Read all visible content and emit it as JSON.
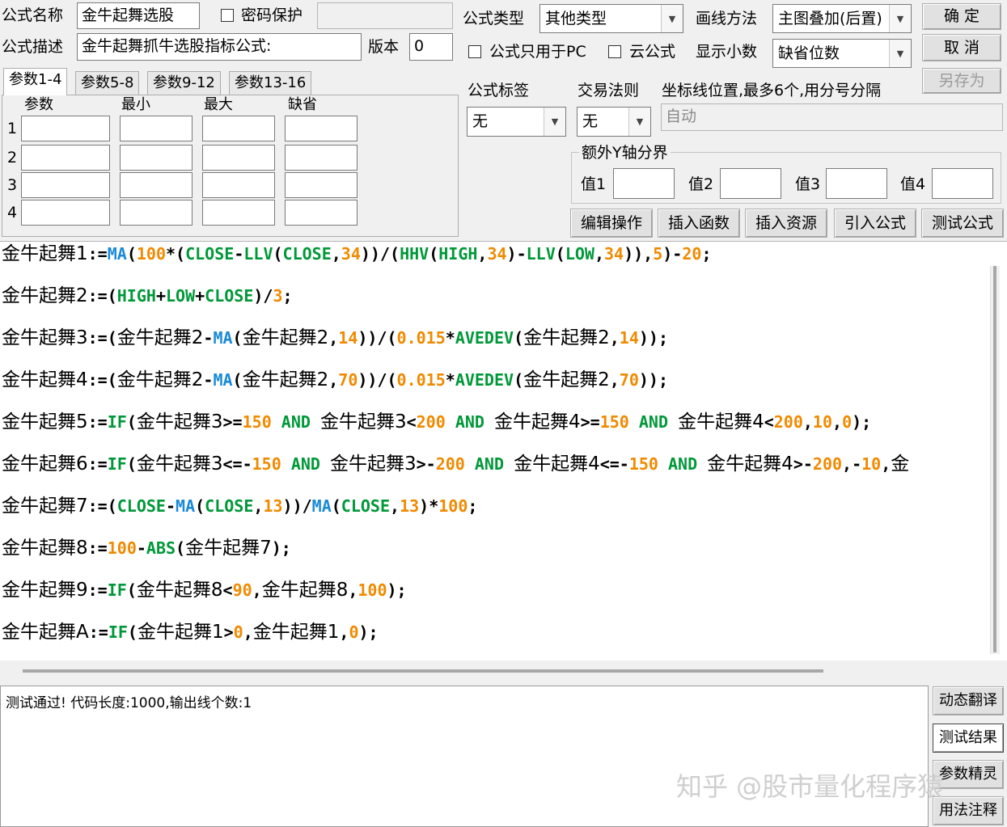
{
  "header": {
    "formula_name_label": "公式名称",
    "formula_name_value": "金牛起舞选股",
    "password_label": "密码保护",
    "formula_desc_label": "公式描述",
    "formula_desc_value": "金牛起舞抓牛选股指标公式:",
    "version_label": "版本",
    "version_value": "0",
    "formula_type_label": "公式类型",
    "formula_type_value": "其他类型",
    "draw_method_label": "画线方法",
    "draw_method_value": "主图叠加(后置)",
    "pc_only_label": "公式只用于PC",
    "cloud_label": "云公式",
    "decimals_label": "显示小数",
    "decimals_value": "缺省位数"
  },
  "buttons": {
    "ok": "确 定",
    "cancel": "取 消",
    "save_as": "另存为",
    "edit_ops": "编辑操作",
    "insert_func": "插入函数",
    "insert_res": "插入资源",
    "import_formula": "引入公式",
    "test_formula": "测试公式",
    "dyn_translate": "动态翻译",
    "test_result": "测试结果",
    "param_wizard": "参数精灵",
    "usage_notes": "用法注释"
  },
  "tabs": [
    "参数1-4",
    "参数5-8",
    "参数9-12",
    "参数13-16"
  ],
  "params": {
    "col_headers": [
      "参数",
      "最小",
      "最大",
      "缺省"
    ],
    "rows": [
      "1",
      "2",
      "3",
      "4"
    ]
  },
  "right_panel": {
    "tag_label": "公式标签",
    "tag_value": "无",
    "trade_rule_label": "交易法则",
    "trade_rule_value": "无",
    "axis_label": "坐标线位置,最多6个,用分号分隔",
    "axis_value": "自动",
    "yaxis_group": "额外Y轴分界",
    "values": [
      "值1",
      "值2",
      "值3",
      "值4"
    ]
  },
  "code_lines": [
    [
      [
        "cn",
        "金牛起舞1"
      ],
      [
        "op",
        ":="
      ],
      [
        "fn",
        "MA"
      ],
      [
        "op",
        "("
      ],
      [
        "num",
        "100"
      ],
      [
        "op",
        "*("
      ],
      [
        "var",
        "CLOSE"
      ],
      [
        "op",
        "-"
      ],
      [
        "var",
        "LLV"
      ],
      [
        "op",
        "("
      ],
      [
        "var",
        "CLOSE"
      ],
      [
        "op",
        ","
      ],
      [
        "num",
        "34"
      ],
      [
        "op",
        "))/("
      ],
      [
        "var",
        "HHV"
      ],
      [
        "op",
        "("
      ],
      [
        "var",
        "HIGH"
      ],
      [
        "op",
        ","
      ],
      [
        "num",
        "34"
      ],
      [
        "op",
        ")-"
      ],
      [
        "var",
        "LLV"
      ],
      [
        "op",
        "("
      ],
      [
        "var",
        "LOW"
      ],
      [
        "op",
        ","
      ],
      [
        "num",
        "34"
      ],
      [
        "op",
        ")),"
      ],
      [
        "num",
        "5"
      ],
      [
        "op",
        ")-"
      ],
      [
        "num",
        "20"
      ],
      [
        "op",
        ";"
      ]
    ],
    [
      [
        "cn",
        "金牛起舞2"
      ],
      [
        "op",
        ":=("
      ],
      [
        "var",
        "HIGH"
      ],
      [
        "op",
        "+"
      ],
      [
        "var",
        "LOW"
      ],
      [
        "op",
        "+"
      ],
      [
        "var",
        "CLOSE"
      ],
      [
        "op",
        ")/"
      ],
      [
        "num",
        "3"
      ],
      [
        "op",
        ";"
      ]
    ],
    [
      [
        "cn",
        "金牛起舞3"
      ],
      [
        "op",
        ":=("
      ],
      [
        "cn",
        "金牛起舞2"
      ],
      [
        "op",
        "-"
      ],
      [
        "fn",
        "MA"
      ],
      [
        "op",
        "("
      ],
      [
        "cn",
        "金牛起舞2"
      ],
      [
        "op",
        ","
      ],
      [
        "num",
        "14"
      ],
      [
        "op",
        "))/("
      ],
      [
        "num",
        "0.015"
      ],
      [
        "op",
        "*"
      ],
      [
        "var",
        "AVEDEV"
      ],
      [
        "op",
        "("
      ],
      [
        "cn",
        "金牛起舞2"
      ],
      [
        "op",
        ","
      ],
      [
        "num",
        "14"
      ],
      [
        "op",
        "));"
      ]
    ],
    [
      [
        "cn",
        "金牛起舞4"
      ],
      [
        "op",
        ":=("
      ],
      [
        "cn",
        "金牛起舞2"
      ],
      [
        "op",
        "-"
      ],
      [
        "fn",
        "MA"
      ],
      [
        "op",
        "("
      ],
      [
        "cn",
        "金牛起舞2"
      ],
      [
        "op",
        ","
      ],
      [
        "num",
        "70"
      ],
      [
        "op",
        "))/("
      ],
      [
        "num",
        "0.015"
      ],
      [
        "op",
        "*"
      ],
      [
        "var",
        "AVEDEV"
      ],
      [
        "op",
        "("
      ],
      [
        "cn",
        "金牛起舞2"
      ],
      [
        "op",
        ","
      ],
      [
        "num",
        "70"
      ],
      [
        "op",
        "));"
      ]
    ],
    [
      [
        "cn",
        "金牛起舞5"
      ],
      [
        "op",
        ":="
      ],
      [
        "var",
        "IF"
      ],
      [
        "op",
        "("
      ],
      [
        "cn",
        "金牛起舞3"
      ],
      [
        "op",
        ">="
      ],
      [
        "num",
        "150"
      ],
      [
        "op",
        " "
      ],
      [
        "var",
        "AND"
      ],
      [
        "op",
        " "
      ],
      [
        "cn",
        "金牛起舞3"
      ],
      [
        "op",
        "<"
      ],
      [
        "num",
        "200"
      ],
      [
        "op",
        " "
      ],
      [
        "var",
        "AND"
      ],
      [
        "op",
        " "
      ],
      [
        "cn",
        "金牛起舞4"
      ],
      [
        "op",
        ">="
      ],
      [
        "num",
        "150"
      ],
      [
        "op",
        " "
      ],
      [
        "var",
        "AND"
      ],
      [
        "op",
        " "
      ],
      [
        "cn",
        "金牛起舞4"
      ],
      [
        "op",
        "<"
      ],
      [
        "num",
        "200"
      ],
      [
        "op",
        ","
      ],
      [
        "num",
        "10"
      ],
      [
        "op",
        ","
      ],
      [
        "num",
        "0"
      ],
      [
        "op",
        ");"
      ]
    ],
    [
      [
        "cn",
        "金牛起舞6"
      ],
      [
        "op",
        ":="
      ],
      [
        "var",
        "IF"
      ],
      [
        "op",
        "("
      ],
      [
        "cn",
        "金牛起舞3"
      ],
      [
        "op",
        "<=-"
      ],
      [
        "num",
        "150"
      ],
      [
        "op",
        " "
      ],
      [
        "var",
        "AND"
      ],
      [
        "op",
        " "
      ],
      [
        "cn",
        "金牛起舞3"
      ],
      [
        "op",
        ">-"
      ],
      [
        "num",
        "200"
      ],
      [
        "op",
        " "
      ],
      [
        "var",
        "AND"
      ],
      [
        "op",
        " "
      ],
      [
        "cn",
        "金牛起舞4"
      ],
      [
        "op",
        "<=-"
      ],
      [
        "num",
        "150"
      ],
      [
        "op",
        " "
      ],
      [
        "var",
        "AND"
      ],
      [
        "op",
        " "
      ],
      [
        "cn",
        "金牛起舞4"
      ],
      [
        "op",
        ">-"
      ],
      [
        "num",
        "200"
      ],
      [
        "op",
        ",-"
      ],
      [
        "num",
        "10"
      ],
      [
        "op",
        ","
      ],
      [
        "cn",
        "金"
      ]
    ],
    [
      [
        "cn",
        "金牛起舞7"
      ],
      [
        "op",
        ":=("
      ],
      [
        "var",
        "CLOSE"
      ],
      [
        "op",
        "-"
      ],
      [
        "fn",
        "MA"
      ],
      [
        "op",
        "("
      ],
      [
        "var",
        "CLOSE"
      ],
      [
        "op",
        ","
      ],
      [
        "num",
        "13"
      ],
      [
        "op",
        "))/"
      ],
      [
        "fn",
        "MA"
      ],
      [
        "op",
        "("
      ],
      [
        "var",
        "CLOSE"
      ],
      [
        "op",
        ","
      ],
      [
        "num",
        "13"
      ],
      [
        "op",
        ")*"
      ],
      [
        "num",
        "100"
      ],
      [
        "op",
        ";"
      ]
    ],
    [
      [
        "cn",
        "金牛起舞8"
      ],
      [
        "op",
        ":="
      ],
      [
        "num",
        "100"
      ],
      [
        "op",
        "-"
      ],
      [
        "var",
        "ABS"
      ],
      [
        "op",
        "("
      ],
      [
        "cn",
        "金牛起舞7"
      ],
      [
        "op",
        ");"
      ]
    ],
    [
      [
        "cn",
        "金牛起舞9"
      ],
      [
        "op",
        ":="
      ],
      [
        "var",
        "IF"
      ],
      [
        "op",
        "("
      ],
      [
        "cn",
        "金牛起舞8"
      ],
      [
        "op",
        "<"
      ],
      [
        "num",
        "90"
      ],
      [
        "op",
        ","
      ],
      [
        "cn",
        "金牛起舞8"
      ],
      [
        "op",
        ","
      ],
      [
        "num",
        "100"
      ],
      [
        "op",
        ");"
      ]
    ],
    [
      [
        "cn",
        "金牛起舞A"
      ],
      [
        "op",
        ":="
      ],
      [
        "var",
        "IF"
      ],
      [
        "op",
        "("
      ],
      [
        "cn",
        "金牛起舞1"
      ],
      [
        "op",
        ">"
      ],
      [
        "num",
        "0"
      ],
      [
        "op",
        ","
      ],
      [
        "cn",
        "金牛起舞1"
      ],
      [
        "op",
        ","
      ],
      [
        "num",
        "0"
      ],
      [
        "op",
        ");"
      ]
    ]
  ],
  "output_text": "测试通过! 代码长度:1000,输出线个数:1",
  "watermark": "知乎 @股市量化程序猿"
}
